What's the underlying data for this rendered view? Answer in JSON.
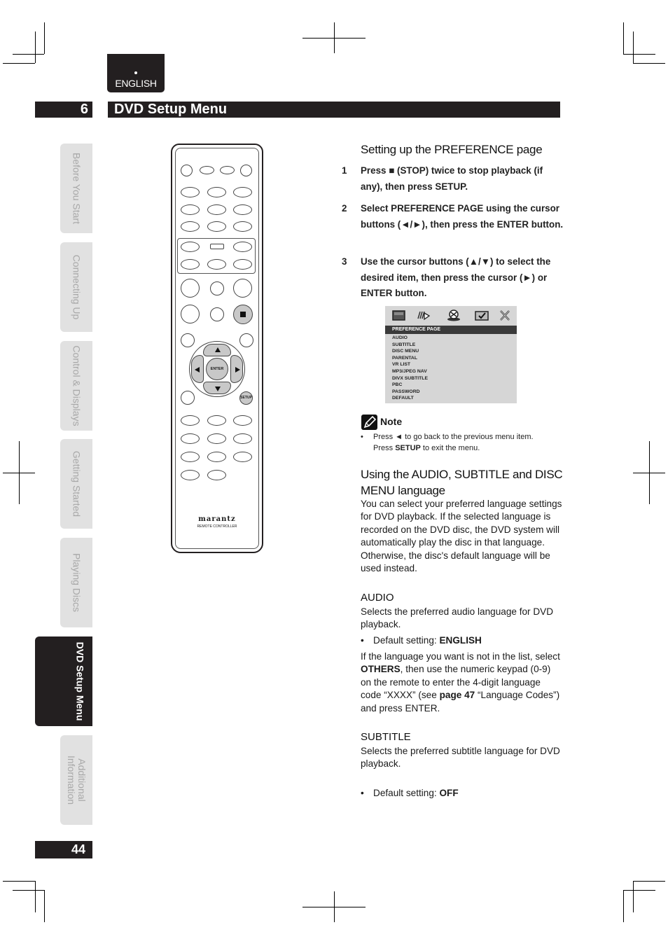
{
  "header": {
    "language_tab": "ENGLISH",
    "chapter_number": "6",
    "chapter_title": "DVD Setup Menu"
  },
  "sidebar": {
    "tabs": [
      {
        "label": "Before You Start",
        "active": false
      },
      {
        "label": "Connecting Up",
        "active": false
      },
      {
        "label": "Control & Displays",
        "active": false
      },
      {
        "label": "Getting Started",
        "active": false
      },
      {
        "label": "Playing Discs",
        "active": false
      },
      {
        "label": "DVD Setup Menu",
        "active": true
      },
      {
        "label": "Additional Information",
        "active": false
      }
    ],
    "additional_line1": "Additional",
    "additional_line2": "Information",
    "page_number": "44"
  },
  "remote": {
    "enter_label": "ENTER",
    "setup_label": "SETUP",
    "stop_icon": "stop-icon",
    "brand": "marantz",
    "subtitle": "REMOTE CONTROLLER"
  },
  "preference": {
    "title": "Setting up the PREFERENCE page",
    "steps": [
      {
        "num": "1",
        "text": "Press ■ (STOP) twice to stop playback (if any), then press SETUP."
      },
      {
        "num": "2",
        "text": "Select PREFERENCE PAGE using the cursor buttons (◄/►), then press the ENTER button."
      },
      {
        "num": "3",
        "text": "Use the cursor buttons (▲/▼) to select the desired item, then press the cursor (►) or ENTER button."
      }
    ]
  },
  "osd": {
    "icons": [
      "general-setup-icon",
      "audio-setup-icon",
      "video-setup-icon",
      "preference-icon",
      "exit-icon"
    ],
    "header": "PREFERENCE PAGE",
    "items": [
      "AUDIO",
      "SUBTITLE",
      "DISC MENU",
      "PARENTAL",
      "VR LIST",
      "MP3/JPEG NAV",
      "DIVX SUBTITLE",
      "PBC",
      "PASSWORD",
      "DEFAULT"
    ],
    "colors": {
      "background": "#d6d6d6",
      "header": "#3a3a3a"
    }
  },
  "note": {
    "label": "Note",
    "line1_pre": "Press ◄ to go back to the previous menu item.",
    "line2_pre": "Press ",
    "line2_bold": "SETUP",
    "line2_post": " to exit the menu."
  },
  "language_section": {
    "title_line1": "Using the AUDIO, SUBTITLE and DISC",
    "title_line2": "MENU language",
    "body": "You can select your preferred language settings for DVD playback. If the selected language is recorded on the DVD disc, the DVD system will automatically play the disc in that language. Otherwise, the disc's default language will be used instead."
  },
  "audio": {
    "title": "AUDIO",
    "body": "Selects the preferred audio language for DVD playback.",
    "default_label": "Default setting: ",
    "default_value": "ENGLISH",
    "others_p1": "If the language you want is not in the list, select ",
    "others_bold": "OTHERS",
    "others_p2": ", then use the numeric keypad (0-9) on the remote to enter the 4-digit language code “XXXX” (see ",
    "page_ref": "page 47",
    "others_p3": " “Language Codes”) and press ENTER."
  },
  "subtitle": {
    "title": "SUBTITLE",
    "body": "Selects the preferred subtitle language for DVD playback.",
    "default_label": "Default setting: ",
    "default_value": "OFF"
  }
}
